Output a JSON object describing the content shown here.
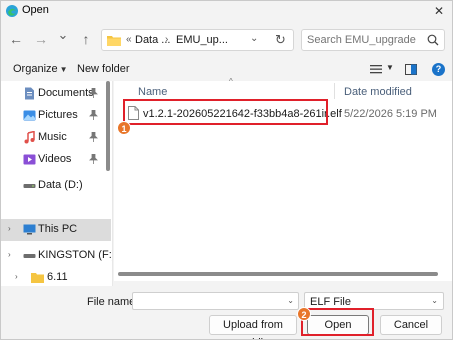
{
  "window": {
    "title": "Open",
    "close_glyph": "✕"
  },
  "nav": {
    "back_glyph": "←",
    "forward_glyph": "→",
    "history_glyph": "⌄",
    "up_glyph": "↑",
    "breadcrumb_sep": "«",
    "breadcrumb": [
      "Data ...",
      "EMU_up..."
    ],
    "crumb_sep": "›",
    "address_dropdown_glyph": "⌄",
    "refresh_glyph": "↻",
    "search_placeholder": "Search EMU_upgrade"
  },
  "toolbar": {
    "organize_label": "Organize",
    "organize_caret": "▼",
    "new_folder_label": "New folder",
    "view_caret": "▼",
    "help_glyph": "?"
  },
  "sidebar": {
    "items": [
      {
        "label": "Documents",
        "icon": "documents-icon",
        "pinned": true
      },
      {
        "label": "Pictures",
        "icon": "pictures-icon",
        "pinned": true
      },
      {
        "label": "Music",
        "icon": "music-icon",
        "pinned": true
      },
      {
        "label": "Videos",
        "icon": "videos-icon",
        "pinned": true
      },
      {
        "label": "Data (D:)",
        "icon": "drive-icon",
        "pinned": false
      },
      {
        "label": "This PC",
        "icon": "pc-icon",
        "pinned": false,
        "selected": true,
        "expand": "›"
      },
      {
        "label": "KINGSTON (F:)",
        "icon": "usb-drive-icon",
        "pinned": false,
        "expand": "›"
      },
      {
        "label": "6.11",
        "icon": "folder-icon",
        "pinned": false,
        "expand": "›"
      }
    ]
  },
  "files": {
    "sort_caret": "^",
    "columns": {
      "name": "Name",
      "date": "Date modified"
    },
    "rows": [
      {
        "name": "v1.2.1-202605221642-f33bb4a8-261ir.elf",
        "date": "5/22/2026 5:19 PM"
      }
    ]
  },
  "annotations": {
    "step1": "1",
    "step2": "2"
  },
  "footer": {
    "file_name_label": "File name:",
    "file_name_value": "",
    "file_name_dropdown": "⌄",
    "filter_value": "ELF File",
    "filter_dropdown": "⌄",
    "upload_label": "Upload from mobile",
    "open_label": "Open",
    "cancel_label": "Cancel"
  },
  "colors": {
    "accent": "#1a73c9",
    "highlight": "#e0202a",
    "badge": "#e8762a"
  }
}
